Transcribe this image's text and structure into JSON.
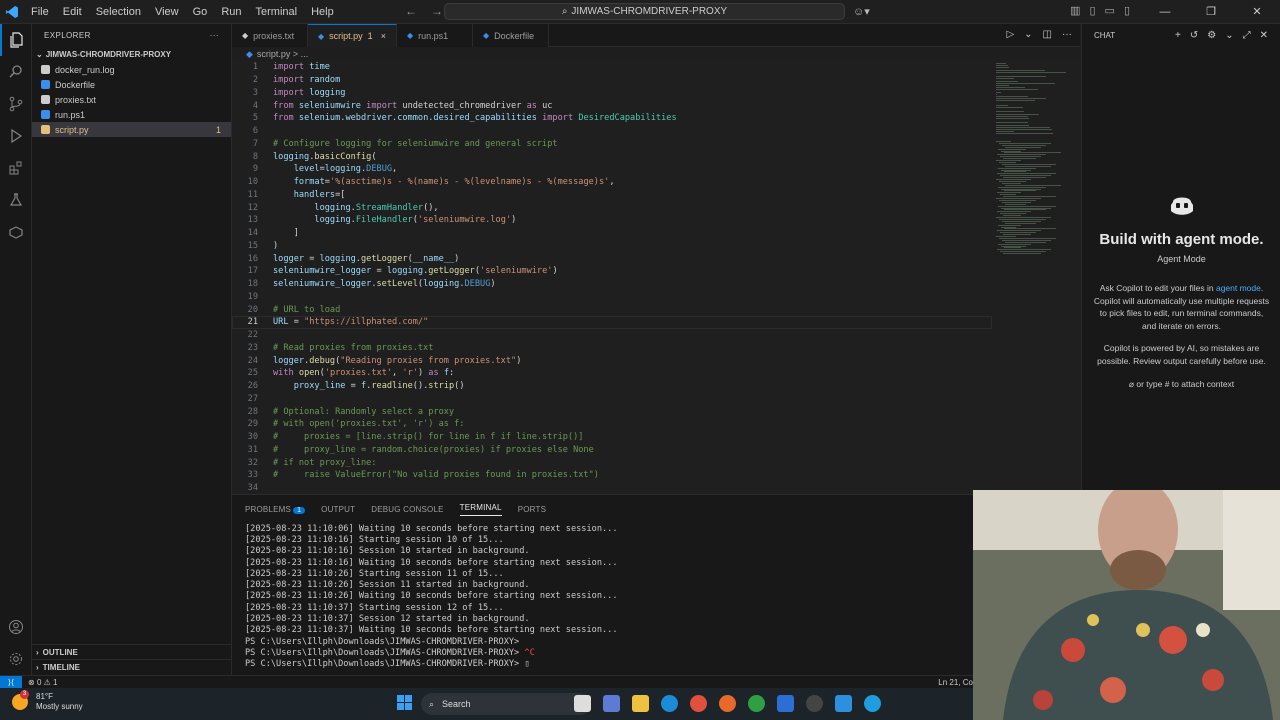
{
  "titlebar": {
    "menu": [
      "File",
      "Edit",
      "Selection",
      "View",
      "Go",
      "Run",
      "Terminal",
      "Help"
    ],
    "search_text": "JIMWAS-CHROMDRIVER-PROXY"
  },
  "sidebar": {
    "title": "EXPLORER",
    "folder": "JIMWAS-CHROMDRIVER-PROXY",
    "files": [
      {
        "name": "docker_run.log",
        "icon_color": "#cccccc"
      },
      {
        "name": "Dockerfile",
        "icon_color": "#3b8eea"
      },
      {
        "name": "proxies.txt",
        "icon_color": "#cccccc"
      },
      {
        "name": "run.ps1",
        "icon_color": "#3b8eea"
      },
      {
        "name": "script.py",
        "icon_color": "#e5c07b",
        "badge": "1",
        "selected": true
      }
    ],
    "outline": "OUTLINE",
    "timeline": "TIMELINE"
  },
  "tabs": [
    {
      "label": "proxies.txt"
    },
    {
      "label": "script.py",
      "badge": "1",
      "close": "×",
      "active": true
    },
    {
      "label": "run.ps1"
    },
    {
      "label": "Dockerfile"
    }
  ],
  "breadcrumb": "script.py > ...",
  "editor": {
    "current_line": 21,
    "lines": [
      [
        [
          "kw",
          "import"
        ],
        [
          "df",
          " "
        ],
        [
          "nm",
          "time"
        ]
      ],
      [
        [
          "kw",
          "import"
        ],
        [
          "df",
          " "
        ],
        [
          "nm",
          "random"
        ]
      ],
      [
        [
          "kw",
          "import"
        ],
        [
          "df",
          " "
        ],
        [
          "nm",
          "logging"
        ]
      ],
      [
        [
          "kw",
          "from"
        ],
        [
          "df",
          " "
        ],
        [
          "nm",
          "seleniumwire"
        ],
        [
          "df",
          " "
        ],
        [
          "kw",
          "import"
        ],
        [
          "df",
          " undetected_chromedriver "
        ],
        [
          "kw",
          "as"
        ],
        [
          "df",
          " uc"
        ]
      ],
      [
        [
          "kw",
          "from"
        ],
        [
          "df",
          " "
        ],
        [
          "nm",
          "selenium.webdriver.common.desired_capabilities"
        ],
        [
          "df",
          " "
        ],
        [
          "kw",
          "import"
        ],
        [
          "df",
          " "
        ],
        [
          "cl",
          "DesiredCapabilities"
        ]
      ],
      [],
      [
        [
          "cm",
          "# Configure logging for seleniumwire and general script"
        ]
      ],
      [
        [
          "nm",
          "logging"
        ],
        [
          "df",
          "."
        ],
        [
          "fn",
          "basicConfig"
        ],
        [
          "df",
          "("
        ]
      ],
      [
        [
          "df",
          "    "
        ],
        [
          "nm",
          "level"
        ],
        [
          "df",
          "="
        ],
        [
          "nm",
          "logging"
        ],
        [
          "df",
          "."
        ],
        [
          "bl",
          "DEBUG"
        ],
        [
          "df",
          ","
        ]
      ],
      [
        [
          "df",
          "    "
        ],
        [
          "nm",
          "format"
        ],
        [
          "df",
          "="
        ],
        [
          "st",
          "'%(asctime)s - %(name)s - %(levelname)s - %(message)s'"
        ],
        [
          "df",
          ","
        ]
      ],
      [
        [
          "df",
          "    "
        ],
        [
          "nm",
          "handlers"
        ],
        [
          "df",
          "=["
        ]
      ],
      [
        [
          "df",
          "        "
        ],
        [
          "nm",
          "logging"
        ],
        [
          "df",
          "."
        ],
        [
          "cl",
          "StreamHandler"
        ],
        [
          "df",
          "(),"
        ]
      ],
      [
        [
          "df",
          "        "
        ],
        [
          "nm",
          "logging"
        ],
        [
          "df",
          "."
        ],
        [
          "cl",
          "FileHandler"
        ],
        [
          "df",
          "("
        ],
        [
          "st",
          "'seleniumwire.log'"
        ],
        [
          "df",
          ")"
        ]
      ],
      [
        [
          "df",
          "    ]"
        ]
      ],
      [
        [
          "df",
          ")"
        ]
      ],
      [
        [
          "nm",
          "logger"
        ],
        [
          "df",
          " = "
        ],
        [
          "nm",
          "logging"
        ],
        [
          "df",
          "."
        ],
        [
          "fn",
          "getLogger"
        ],
        [
          "df",
          "("
        ],
        [
          "nm",
          "__name__"
        ],
        [
          "df",
          ")"
        ]
      ],
      [
        [
          "nm",
          "seleniumwire_logger"
        ],
        [
          "df",
          " = "
        ],
        [
          "nm",
          "logging"
        ],
        [
          "df",
          "."
        ],
        [
          "fn",
          "getLogger"
        ],
        [
          "df",
          "("
        ],
        [
          "st",
          "'seleniumwire'"
        ],
        [
          "df",
          ")"
        ]
      ],
      [
        [
          "nm",
          "seleniumwire_logger"
        ],
        [
          "df",
          "."
        ],
        [
          "fn",
          "setLevel"
        ],
        [
          "df",
          "("
        ],
        [
          "nm",
          "logging"
        ],
        [
          "df",
          "."
        ],
        [
          "bl",
          "DEBUG"
        ],
        [
          "df",
          ")"
        ]
      ],
      [],
      [
        [
          "cm",
          "# URL to load"
        ]
      ],
      [
        [
          "nm",
          "URL"
        ],
        [
          "df",
          " = "
        ],
        [
          "st",
          "\"https://illphated.com/\""
        ]
      ],
      [],
      [
        [
          "cm",
          "# Read proxies from proxies.txt"
        ]
      ],
      [
        [
          "nm",
          "logger"
        ],
        [
          "df",
          "."
        ],
        [
          "fn",
          "debug"
        ],
        [
          "df",
          "("
        ],
        [
          "st",
          "\"Reading proxies from proxies.txt\""
        ],
        [
          "df",
          ")"
        ]
      ],
      [
        [
          "kw",
          "with"
        ],
        [
          "df",
          " "
        ],
        [
          "fn",
          "open"
        ],
        [
          "df",
          "("
        ],
        [
          "st",
          "'proxies.txt'"
        ],
        [
          "df",
          ", "
        ],
        [
          "st",
          "'r'"
        ],
        [
          "df",
          ") "
        ],
        [
          "kw",
          "as"
        ],
        [
          "df",
          " "
        ],
        [
          "nm",
          "f"
        ],
        [
          "df",
          ":"
        ]
      ],
      [
        [
          "df",
          "    "
        ],
        [
          "nm",
          "proxy_line"
        ],
        [
          "df",
          " = "
        ],
        [
          "nm",
          "f"
        ],
        [
          "df",
          "."
        ],
        [
          "fn",
          "readline"
        ],
        [
          "df",
          "()."
        ],
        [
          "fn",
          "strip"
        ],
        [
          "df",
          "()"
        ]
      ],
      [],
      [
        [
          "cm",
          "# Optional: Randomly select a proxy"
        ]
      ],
      [
        [
          "cm",
          "# with open('proxies.txt', 'r') as f:"
        ]
      ],
      [
        [
          "cm",
          "#     proxies = [line.strip() for line in f if line.strip()]"
        ]
      ],
      [
        [
          "cm",
          "#     proxy_line = random.choice(proxies) if proxies else None"
        ]
      ],
      [
        [
          "cm",
          "# if not proxy_line:"
        ]
      ],
      [
        [
          "cm",
          "#     raise ValueError(\"No valid proxies found in proxies.txt\")"
        ]
      ],
      []
    ]
  },
  "panel": {
    "tabs": [
      "PROBLEMS",
      "OUTPUT",
      "DEBUG CONSOLE",
      "TERMINAL",
      "PORTS"
    ],
    "problems_badge": "1",
    "active_tab": "TERMINAL",
    "terminal_lines": [
      "[2025-08-23 11:10:06] Waiting 10 seconds before starting next session...",
      "[2025-08-23 11:10:16] Starting session 10 of 15...",
      "[2025-08-23 11:10:16] Session 10 started in background.",
      "[2025-08-23 11:10:16] Waiting 10 seconds before starting next session...",
      "[2025-08-23 11:10:26] Starting session 11 of 15...",
      "[2025-08-23 11:10:26] Session 11 started in background.",
      "[2025-08-23 11:10:26] Waiting 10 seconds before starting next session...",
      "[2025-08-23 11:10:37] Starting session 12 of 15...",
      "[2025-08-23 11:10:37] Session 12 started in background.",
      "[2025-08-23 11:10:37] Waiting 10 seconds before starting next session..."
    ],
    "prompts": [
      {
        "text": "PS C:\\Users\\Illph\\Downloads\\JIMWAS-CHROMDRIVER-PROXY>",
        "suffix": ""
      },
      {
        "text": "PS C:\\Users\\Illph\\Downloads\\JIMWAS-CHROMDRIVER-PROXY>",
        "suffix": " ^C"
      },
      {
        "text": "PS C:\\Users\\Illph\\Downloads\\JIMWAS-CHROMDRIVER-PROXY>",
        "suffix": " ▯"
      }
    ]
  },
  "chat": {
    "title": "CHAT",
    "heading": "Build with agent mode.",
    "subheading": "Agent Mode",
    "desc_before": "Ask Copilot to edit your files in ",
    "desc_link": "agent mode",
    "desc_after": ". Copilot will automatically use multiple requests to pick files to edit, run terminal commands, and iterate on errors.",
    "disclaimer": "Copilot is powered by AI, so mistakes are possible. Review output carefully before use.",
    "context_hint": "or type # to attach context"
  },
  "statusbar": {
    "errors": "0",
    "warnings": "1",
    "position": "Ln 21, Co"
  },
  "taskbar": {
    "temperature": "81°F",
    "weather": "Mostly sunny",
    "weather_badge": "3",
    "search_placeholder": "Search"
  }
}
